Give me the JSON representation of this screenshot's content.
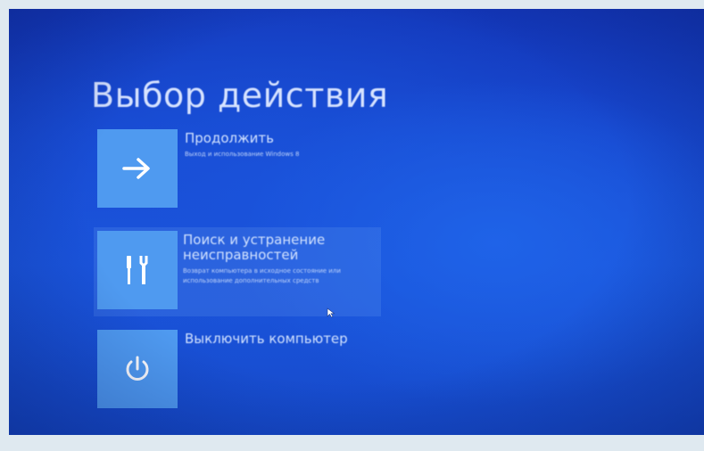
{
  "screen": {
    "title": "Выбор действия"
  },
  "options": [
    {
      "title": "Продолжить",
      "description": "Выход и использование Windows 8",
      "icon": "arrow-right-icon"
    },
    {
      "title": "Поиск и устранение неисправностей",
      "description": "Возврат компьютера в исходное состояние или использование дополнительных средств",
      "icon": "tools-icon"
    },
    {
      "title": "Выключить компьютер",
      "description": "",
      "icon": "power-icon"
    }
  ],
  "colors": {
    "background": "#1a52da",
    "tile": "#4f9af0",
    "text": "#d7e3ff"
  }
}
